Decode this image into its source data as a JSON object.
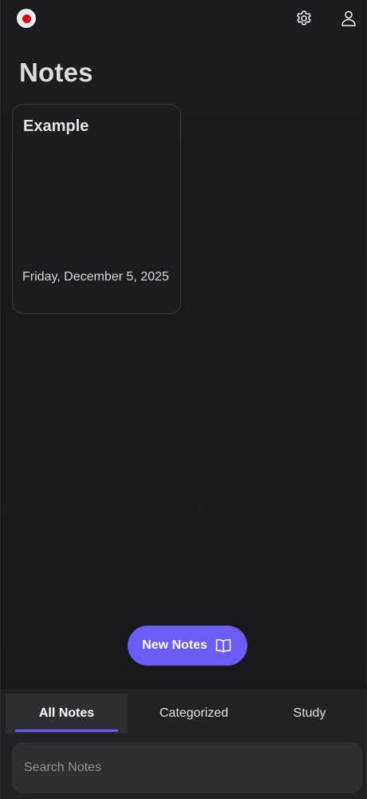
{
  "header": {
    "logo_icon": "japan-flag-icon",
    "settings_icon": "gear-icon",
    "profile_icon": "user-icon"
  },
  "page": {
    "title": "Notes"
  },
  "notes": [
    {
      "title": "Example",
      "date": "Friday, December 5, 2025"
    }
  ],
  "actions": {
    "new_notes_label": "New Notes",
    "new_notes_icon": "open-book-icon",
    "accent_color": "#6c5cf5"
  },
  "tabs": [
    {
      "label": "All Notes",
      "active": true
    },
    {
      "label": "Categorized",
      "active": false
    },
    {
      "label": "Study",
      "active": false
    }
  ],
  "search": {
    "placeholder": "Search Notes",
    "value": ""
  }
}
